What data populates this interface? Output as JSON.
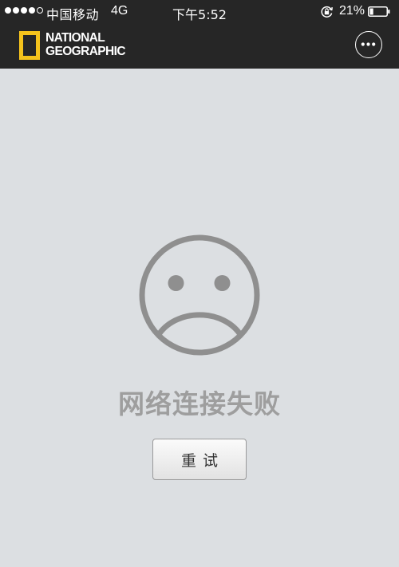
{
  "status_bar": {
    "signal_bars_filled": 4,
    "signal_bars_total": 5,
    "carrier": "中国移动",
    "network": "4G",
    "time": "下午5:52",
    "battery_percent_text": "21%",
    "battery_level": 0.21
  },
  "nav_bar": {
    "logo_line1": "NATIONAL",
    "logo_line2": "GEOGRAPHIC",
    "brand_color": "#f4c21c",
    "more_icon": "more-dots-icon"
  },
  "content": {
    "icon": "sad-face-icon",
    "error_message": "网络连接失败",
    "retry_label": "重试"
  },
  "colors": {
    "top_bar": "#262626",
    "background": "#dcdfe2",
    "icon_gray": "#8f8f8f",
    "message_gray": "#9e9e9e"
  }
}
